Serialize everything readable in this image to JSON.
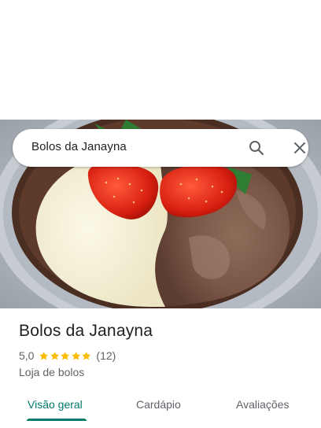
{
  "search": {
    "query": "Bolos da Janayna",
    "search_icon": "search-icon",
    "close_icon": "close-icon"
  },
  "photo": {
    "subject": "cake-photo"
  },
  "place": {
    "title": "Bolos da Janayna",
    "rating": "5,0",
    "stars": 5,
    "review_count": "(12)",
    "category": "Loja de bolos"
  },
  "tabs": [
    {
      "label": "Visão geral",
      "active": true
    },
    {
      "label": "Cardápio",
      "active": false
    },
    {
      "label": "Avaliações",
      "active": false
    }
  ],
  "colors": {
    "accent": "#00796b",
    "star": "#fbbc04",
    "secondary_text": "#5f6368"
  }
}
